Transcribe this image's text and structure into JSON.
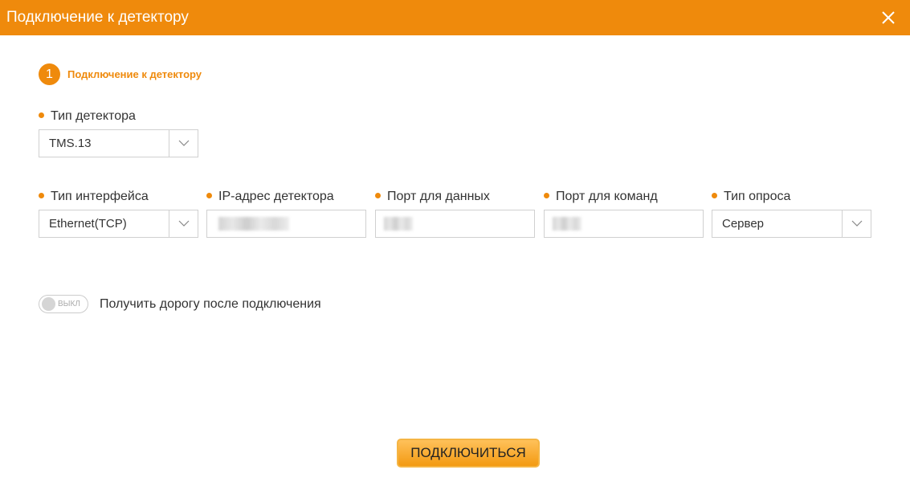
{
  "window": {
    "title": "Подключение к детектору",
    "close_icon": "close-icon"
  },
  "colors": {
    "accent": "#ef8a0c",
    "border": "#d0d0d0",
    "text": "#333333"
  },
  "step": {
    "number": "1",
    "label": "Подключение к детектору"
  },
  "fields": {
    "detector_type": {
      "label": "Тип детектора",
      "value": "TMS.13"
    },
    "interface_type": {
      "label": "Тип интерфейса",
      "value": "Ethernet(TCP)"
    },
    "ip_address": {
      "label": "IP-адрес детектора"
    },
    "data_port": {
      "label": "Порт для данных"
    },
    "command_port": {
      "label": "Порт для команд"
    },
    "poll_type": {
      "label": "Тип опроса",
      "value": "Сервер"
    }
  },
  "toggle": {
    "state_label": "ВЫКЛ",
    "label": "Получить дорогу после подключения",
    "on": false
  },
  "connect_button": {
    "label": "ПОДКЛЮЧИТЬСЯ"
  }
}
